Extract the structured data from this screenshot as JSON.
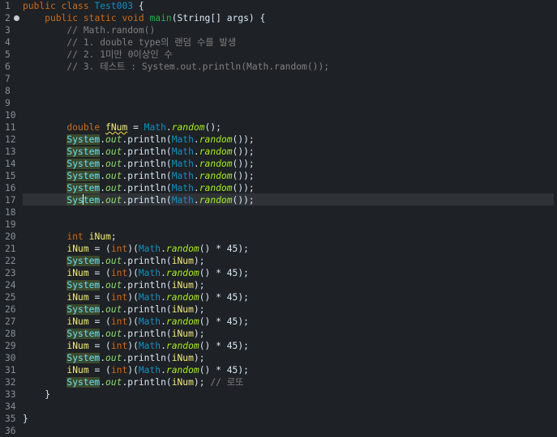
{
  "editor": {
    "line_numbers": [
      "1",
      "2",
      "3",
      "4",
      "5",
      "6",
      "7",
      "8",
      "9",
      "10",
      "11",
      "12",
      "13",
      "14",
      "15",
      "16",
      "17",
      "18",
      "19",
      "20",
      "21",
      "22",
      "23",
      "24",
      "25",
      "26",
      "27",
      "28",
      "29",
      "30",
      "31",
      "32",
      "33",
      "34",
      "35",
      "36"
    ],
    "class_decl": {
      "kw1": "public",
      "kw2": "class",
      "name": "Test003",
      "brace": "{"
    },
    "main_decl": {
      "kw1": "public",
      "kw2": "static",
      "kw3": "void",
      "name": "main",
      "params": "(String[] args) {"
    },
    "comments": [
      "// Math.random()",
      "// 1. double type의 랜덤 수를 발생",
      "// 2. 1미만 0이상인 수",
      "// 3. 테스트 : System.out.println(Math.random());"
    ],
    "double_line": {
      "type": "double",
      "var": "fNum",
      "eq": " = ",
      "cls": "Math",
      "dot": ".",
      "method": "random",
      "tail": "();"
    },
    "println_random": {
      "sys": "System",
      "out": "out",
      "println": "println(",
      "cls": "Math",
      "method": "random",
      "tail": "());"
    },
    "int_decl": {
      "type": "int",
      "var": "iNum",
      "semi": ";"
    },
    "assign": {
      "var": "iNum",
      "eq": " = (",
      "cast": "int",
      "close": ")(",
      "cls": "Math",
      "method": "random",
      "tail": "() * 45);"
    },
    "println_inum": {
      "sys": "System",
      "out": "out",
      "println": "println(",
      "arg": "iNum",
      "tail": ");"
    },
    "last_comment": "// 로또",
    "close_brace": "}"
  }
}
